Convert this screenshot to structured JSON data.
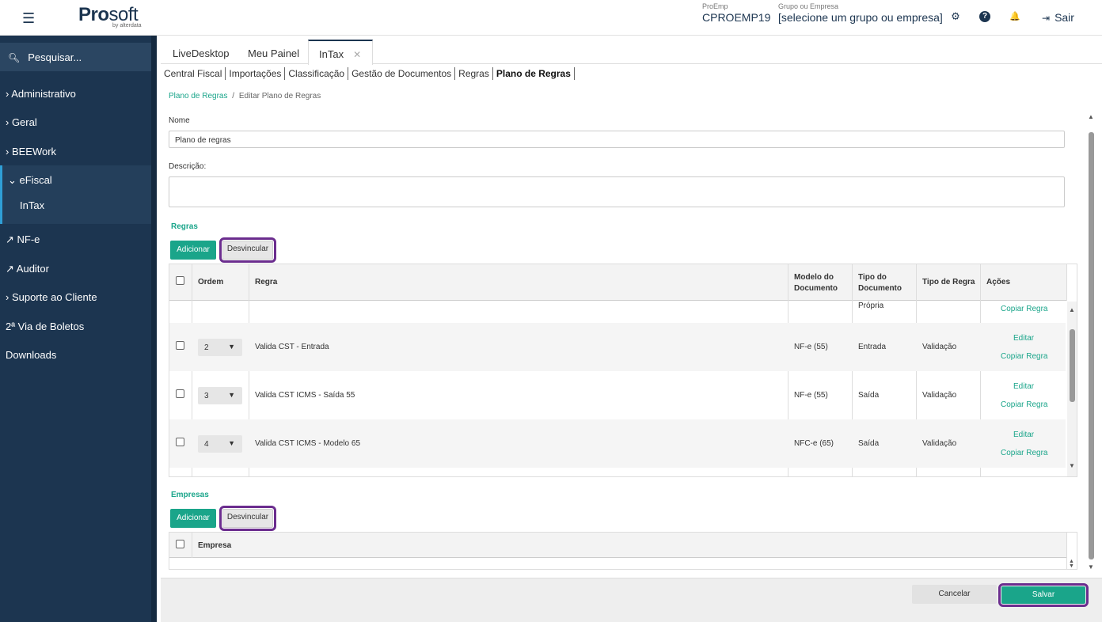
{
  "header": {
    "menu_icon": "hamburger-icon",
    "logo_pro": "Pro",
    "logo_soft": "soft",
    "logo_by": "by alterdata",
    "proemp_label": "ProEmp",
    "proemp_value": "CPROEMP19",
    "grupo_label": "Grupo ou Empresa",
    "grupo_value": "[selecione um grupo ou empresa]",
    "settings_icon": "⚙",
    "help_icon": "?",
    "bell_icon": "🔔",
    "sair_icon": "⇥",
    "sair_label": "Sair"
  },
  "sidebar": {
    "search_placeholder": "Pesquisar...",
    "items": [
      {
        "label": "› Administrativo"
      },
      {
        "label": "› Geral"
      },
      {
        "label": "› BEEWork"
      },
      {
        "label": "⌄ eFiscal"
      },
      {
        "label": "InTax"
      },
      {
        "label": "↗ NF-e"
      },
      {
        "label": "↗ Auditor"
      },
      {
        "label": "› Suporte ao Cliente"
      },
      {
        "label": "2ª Via de Boletos"
      },
      {
        "label": "Downloads"
      }
    ]
  },
  "tabs": [
    {
      "label": "LiveDesktop"
    },
    {
      "label": "Meu Painel"
    },
    {
      "label": "InTax",
      "close": "✕"
    }
  ],
  "subnav": [
    "Central Fiscal",
    "Importações",
    "Classificação",
    "Gestão de Documentos",
    "Regras",
    "Plano de Regras"
  ],
  "breadcrumb": {
    "link": "Plano de Regras",
    "sep": "/",
    "current": "Editar Plano de Regras"
  },
  "form": {
    "nome_label": "Nome",
    "nome_value": "Plano de regras",
    "descricao_label": "Descrição:",
    "descricao_value": ""
  },
  "regras": {
    "title": "Regras",
    "add_label": "Adicionar",
    "unlink_label": "Desvincular",
    "columns": [
      "Ordem",
      "Regra",
      "Modelo do Documento",
      "Tipo do Documento",
      "Tipo de Regra",
      "Ações"
    ],
    "partial_row": {
      "tipo_doc": "Própria",
      "copy": "Copiar Regra"
    },
    "rows": [
      {
        "ordem": "2",
        "regra": "Valida CST - Entrada",
        "modelo": "NF-e (55)",
        "tipo_doc": "Entrada",
        "tipo_regra": "Validação",
        "edit": "Editar",
        "copy": "Copiar Regra"
      },
      {
        "ordem": "3",
        "regra": "Valida CST ICMS - Saída 55",
        "modelo": "NF-e (55)",
        "tipo_doc": "Saída",
        "tipo_regra": "Validação",
        "edit": "Editar",
        "copy": "Copiar Regra"
      },
      {
        "ordem": "4",
        "regra": "Valida CST ICMS - Modelo 65",
        "modelo": "NFC-e (65)",
        "tipo_doc": "Saída",
        "tipo_regra": "Validação",
        "edit": "Editar",
        "copy": "Copiar Regra"
      }
    ]
  },
  "empresas": {
    "title": "Empresas",
    "add_label": "Adicionar",
    "unlink_label": "Desvincular",
    "column": "Empresa"
  },
  "footer": {
    "cancel_label": "Cancelar",
    "save_label": "Salvar"
  },
  "colors": {
    "sidebar_bg": "#1c3550",
    "accent_green": "#1aa58a",
    "highlight_purple": "#6b2d8e"
  }
}
